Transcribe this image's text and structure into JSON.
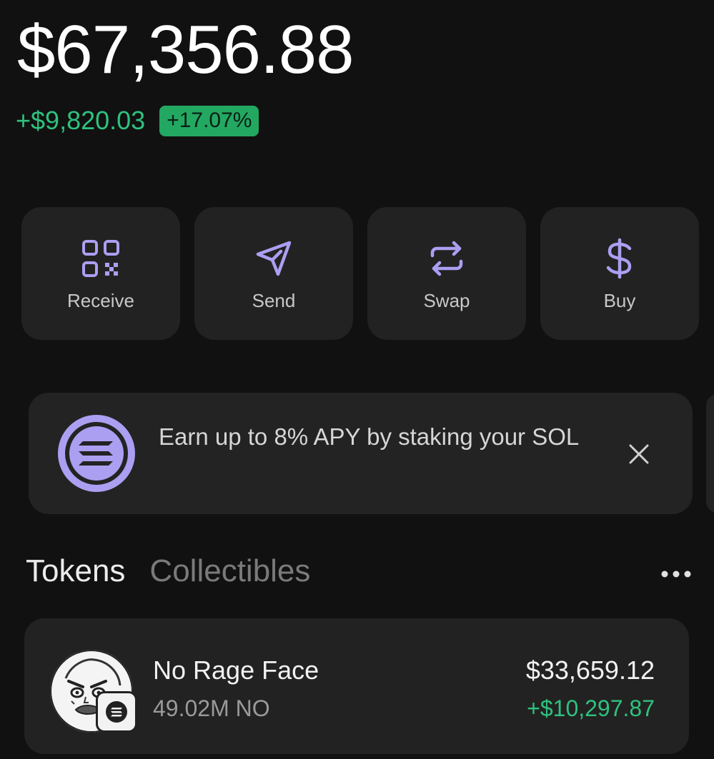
{
  "portfolio": {
    "balance": "$67,356.88",
    "change_amount": "+$9,820.03",
    "change_percent": "+17.07%"
  },
  "actions": [
    {
      "label": "Receive",
      "icon": "qr-code-icon"
    },
    {
      "label": "Send",
      "icon": "send-icon"
    },
    {
      "label": "Swap",
      "icon": "swap-icon"
    },
    {
      "label": "Buy",
      "icon": "dollar-icon"
    }
  ],
  "promo": {
    "text": "Earn up to 8% APY by staking your SOL",
    "icon": "solana-icon"
  },
  "tabs": {
    "tokens": "Tokens",
    "collectibles": "Collectibles",
    "active": "Tokens"
  },
  "tokens": [
    {
      "name": "No Rage Face",
      "amount": "49.02M NO",
      "value": "$33,659.12",
      "change": "+$10,297.87"
    }
  ],
  "colors": {
    "accent": "#ab9ff2",
    "positive": "#2ec27e",
    "badge": "#23a862",
    "background": "#111111",
    "card": "#222222"
  }
}
